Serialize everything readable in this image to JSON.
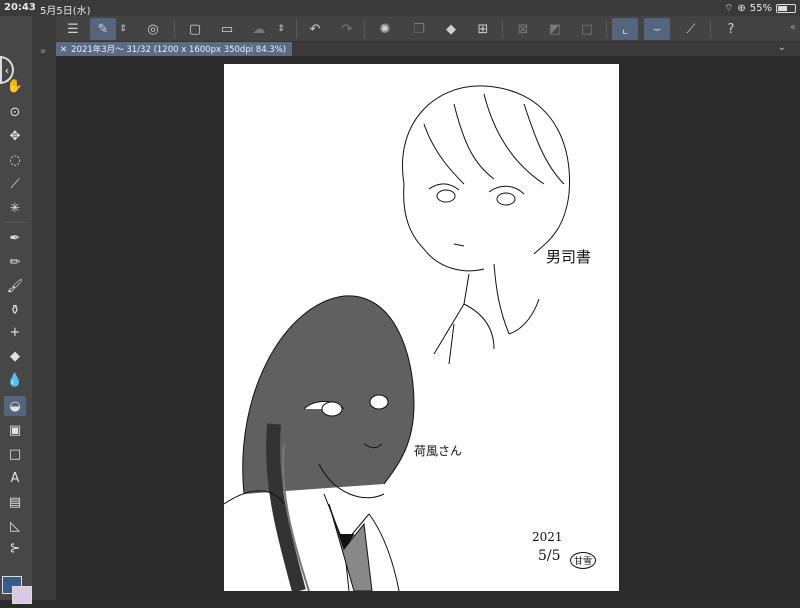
{
  "status_bar": {
    "time": "20:43",
    "date": "5月5日(水)",
    "battery": "55%",
    "battery_level": 0.55
  },
  "toolbar": {
    "buttons": [
      "menu-icon",
      "quick-access-icon",
      "expand-icon",
      "reference-layer-icon",
      "new-file-icon",
      "open-folder-icon",
      "save-cloud-icon",
      "expand-icon",
      "undo-icon",
      "redo-icon",
      "select-all-icon",
      "layer-icon",
      "fill-icon",
      "transform-icon",
      "clear-icon",
      "invert-icon",
      "hide-selection-icon",
      "snap-ruler-icon",
      "snap-brush-icon",
      "symmetry-icon",
      "help-icon"
    ]
  },
  "document_tab": {
    "title": "2021年3月～ 31/32 (1200 x 1600px 350dpi 84.3%)"
  },
  "tools": [
    "hand-icon",
    "zoom-rotate-icon",
    "move-icon",
    "lasso-icon",
    "eyedropper-icon",
    "magic-wand-icon",
    "pen-icon",
    "pencil-icon",
    "brush-icon",
    "airbrush-icon",
    "decoration-icon",
    "eraser-icon",
    "blend-icon",
    "fill-bucket-icon",
    "gradient-icon",
    "rectangle-icon",
    "text-icon",
    "frame-icon",
    "ruler-icon",
    "correct-line-icon"
  ],
  "colors": {
    "main": "#3a5a8a",
    "sub": "#d9c7e3",
    "accent": "#56657e"
  },
  "artwork": {
    "label_top": "男司書",
    "label_bottom": "荷風さん",
    "signature_year": "2021",
    "signature_date": "5/5",
    "signature_name": "甘雪"
  }
}
